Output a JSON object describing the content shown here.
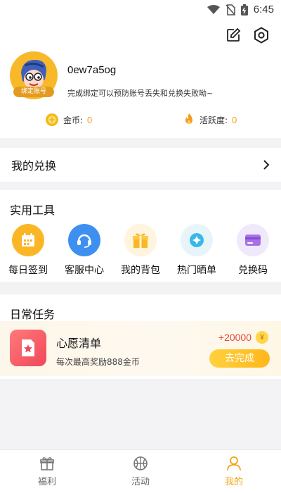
{
  "status_bar": {
    "time": "6:45"
  },
  "profile": {
    "username": "0ew7a5og",
    "bind_tag": "绑定账号",
    "bind_hint": "完成绑定可以预防账号丢失和兑换失败呦~",
    "coins_label": "金币:",
    "coins_value": "0",
    "activity_label": "活跃度:",
    "activity_value": "0"
  },
  "exchange": {
    "title": "我的兑换"
  },
  "tools": {
    "title": "实用工具",
    "items": [
      {
        "label": "每日签到",
        "icon": "calendar-icon"
      },
      {
        "label": "客服中心",
        "icon": "headset-icon"
      },
      {
        "label": "我的背包",
        "icon": "gift-box-icon"
      },
      {
        "label": "热门晒单",
        "icon": "diamond-icon"
      },
      {
        "label": "兑换码",
        "icon": "card-icon"
      }
    ]
  },
  "tasks": {
    "title": "日常任务",
    "item": {
      "title": "心愿清单",
      "desc": "每次最高奖励888金币",
      "reward": "+20000",
      "coin_symbol": "¥",
      "button": "去完成"
    }
  },
  "tabbar": {
    "items": [
      {
        "label": "福利",
        "active": false
      },
      {
        "label": "活动",
        "active": false
      },
      {
        "label": "我的",
        "active": true
      }
    ]
  },
  "colors": {
    "accent": "#f2a516",
    "reward_red": "#e5463c"
  }
}
